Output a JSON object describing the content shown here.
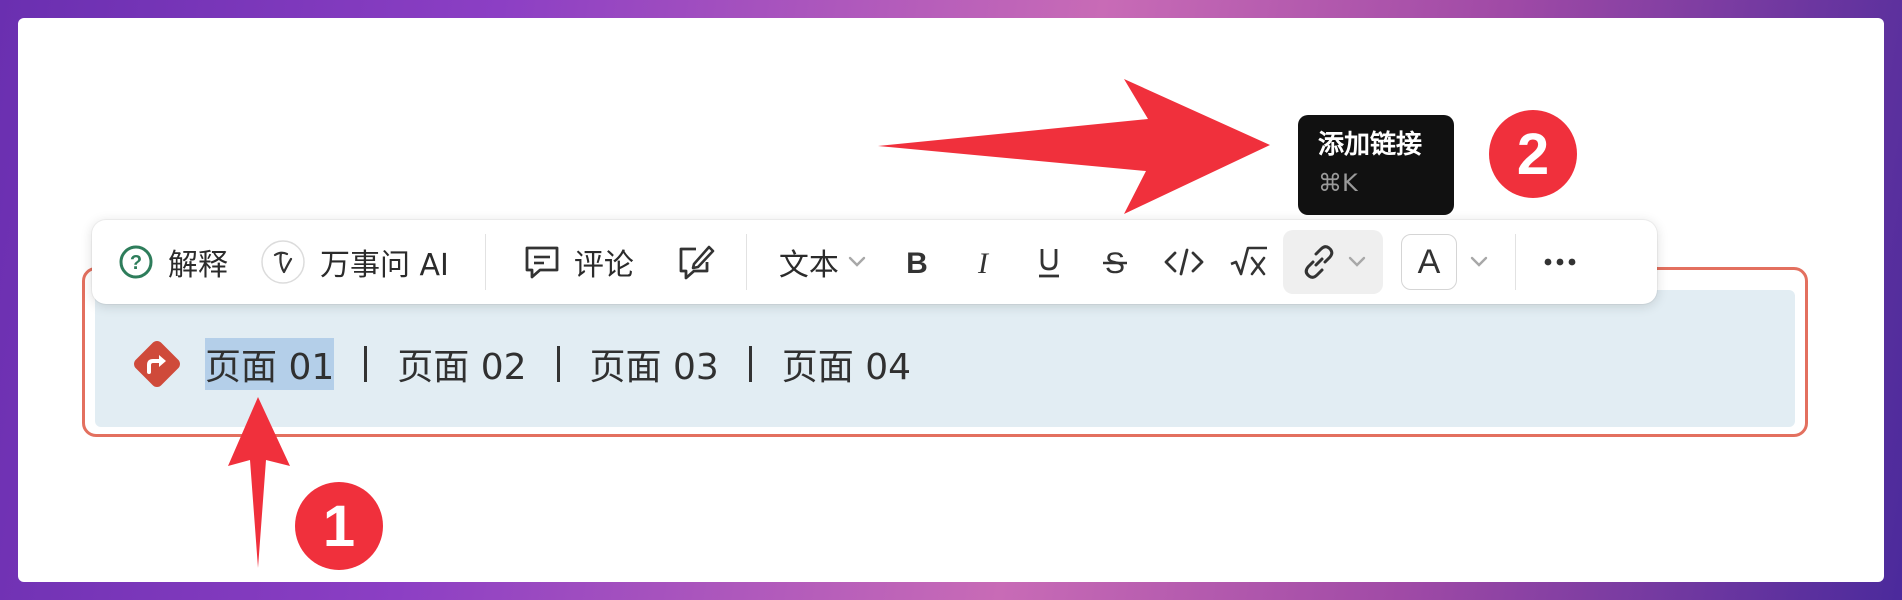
{
  "toolbar": {
    "explain_label": "解释",
    "ai_label": "万事问 AI",
    "comment_label": "评论",
    "text_style_label": "文本",
    "font_color_label": "A",
    "icons": [
      "help-circle-icon",
      "ai-spark-icon",
      "comment-icon",
      "edit-note-icon",
      "bold-icon",
      "italic-icon",
      "underline-icon",
      "strikethrough-icon",
      "code-icon",
      "formula-icon",
      "link-icon",
      "chevron-down-icon",
      "more-icon"
    ]
  },
  "tooltip": {
    "title": "添加链接",
    "shortcut": "⌘K"
  },
  "callout": {
    "icon": "redirect-arrow-icon",
    "icon_color": "#cf4a3a",
    "pages": [
      "页面 01",
      "页面 02",
      "页面 03",
      "页面 04"
    ],
    "selected_index": 0
  },
  "annotations": {
    "badge_1": "1",
    "badge_2": "2",
    "color": "#f0303c"
  }
}
